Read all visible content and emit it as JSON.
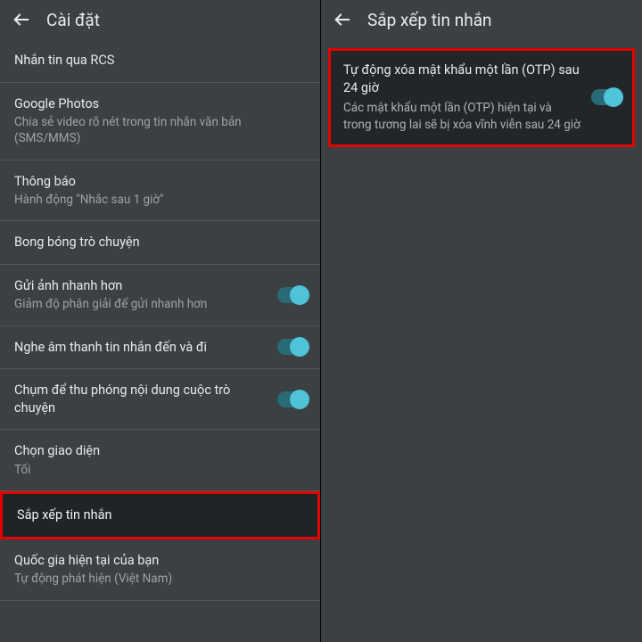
{
  "left": {
    "title": "Cài đặt",
    "items": [
      {
        "title": "Nhắn tin qua RCS",
        "sub": null,
        "toggle": false,
        "highlight": false
      },
      {
        "title": "Google Photos",
        "sub": "Chia sẻ video rõ nét trong tin nhắn văn bản (SMS/MMS)",
        "toggle": false,
        "highlight": false
      },
      {
        "title": "Thông báo",
        "sub": "Hành động \"Nhắc sau 1 giờ\"",
        "toggle": false,
        "highlight": false
      },
      {
        "title": "Bong bóng trò chuyện",
        "sub": null,
        "toggle": false,
        "highlight": false
      },
      {
        "title": "Gửi ảnh nhanh hơn",
        "sub": "Giảm độ phân giải để gửi nhanh hơn",
        "toggle": true,
        "highlight": false
      },
      {
        "title": "Nghe âm thanh tin nhắn đến và đi",
        "sub": null,
        "toggle": true,
        "highlight": false
      },
      {
        "title": "Chụm để thu phóng nội dung cuộc trò chuyện",
        "sub": null,
        "toggle": true,
        "highlight": false
      },
      {
        "title": "Chọn giao diện",
        "sub": "Tối",
        "toggle": false,
        "highlight": false
      },
      {
        "title": "Sắp xếp tin nhắn",
        "sub": null,
        "toggle": false,
        "highlight": true
      },
      {
        "title": "Quốc gia hiện tại của bạn",
        "sub": "Tự động phát hiện (Việt Nam)",
        "toggle": false,
        "highlight": false
      }
    ]
  },
  "right": {
    "title": "Sắp xếp tin nhắn",
    "otp": {
      "title": "Tự động xóa mật khẩu một lần (OTP) sau 24 giờ",
      "sub": "Các mật khẩu một lần (OTP) hiện tại và trong tương lai sẽ bị xóa vĩnh viễn sau 24 giờ",
      "toggle": true
    }
  }
}
